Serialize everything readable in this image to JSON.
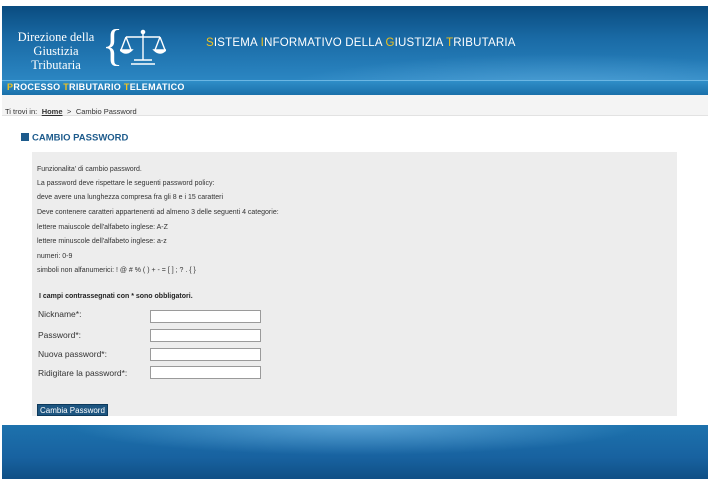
{
  "header": {
    "logo_line1": "Direzione della",
    "logo_line2": "Giustizia Tributaria",
    "system_title": {
      "i1": "S",
      "r1": "ISTEMA ",
      "i2": "I",
      "r2": "NFORMATIVO DELLA ",
      "i3": "G",
      "r3": "IUSTIZIA ",
      "i4": "T",
      "r4": "RIBUTARIA"
    },
    "bar_title": {
      "i1": "P",
      "r1": "ROCESSO ",
      "i2": "T",
      "r2": "RIBUTARIO ",
      "i3": "T",
      "r3": "ELEMATICO"
    }
  },
  "breadcrumb": {
    "prefix": "Ti trovi in:",
    "home": "Home",
    "separator": ">",
    "current": "Cambio Password"
  },
  "page": {
    "title": "CAMBIO PASSWORD"
  },
  "info": {
    "lines": [
      "Funzionalita' di cambio password.",
      "La password deve rispettare le seguenti password policy:",
      "deve avere una lunghezza compresa fra gli 8 e i 15 caratteri",
      "Deve contenere caratteri appartenenti ad almeno 3 delle seguenti 4 categorie:",
      "lettere maiuscole dell'alfabeto inglese: A-Z",
      "lettere minuscole dell'alfabeto inglese: a-z",
      "numeri: 0-9",
      "simboli non alfanumerici: ! @ # % ( ) + - = [ ] ; ? . { }"
    ],
    "required_note": "I campi contrassegnati con * sono obbligatori."
  },
  "form": {
    "fields": [
      {
        "label": "Nickname*:",
        "value": ""
      },
      {
        "label": "Password*:",
        "value": ""
      },
      {
        "label": "Nuova password*:",
        "value": ""
      },
      {
        "label": "Ridigitare la password*:",
        "value": ""
      }
    ],
    "submit_label": "Cambia Password"
  },
  "colors": {
    "header_blue": "#1a6ba6",
    "accent_yellow": "#f2c21b",
    "title_blue": "#1d5b8c",
    "panel_gray": "#ededed"
  }
}
